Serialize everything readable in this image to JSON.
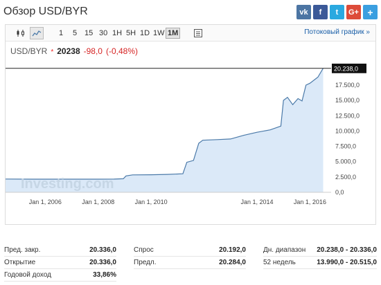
{
  "header": {
    "title": "Обзор USD/BYR",
    "share": [
      {
        "label": "vk",
        "icon": "vk-icon"
      },
      {
        "label": "f",
        "icon": "facebook-icon"
      },
      {
        "label": "t",
        "icon": "twitter-icon"
      },
      {
        "label": "G+",
        "icon": "google-plus-icon"
      },
      {
        "label": "+",
        "icon": "plus-icon"
      }
    ]
  },
  "toolbar": {
    "timeframes": [
      "1",
      "5",
      "15",
      "30",
      "1H",
      "5H",
      "1D",
      "1W",
      "1M"
    ],
    "active_timeframe": "1M",
    "stream_link": "Потоковый график »"
  },
  "quote": {
    "symbol": "USD/BYR",
    "star": "*",
    "last": "20238",
    "change": "-98,0",
    "change_pct": "(-0,48%)"
  },
  "chart_data": {
    "type": "area",
    "x_tick_labels": [
      "Jan 1, 2006",
      "Jan 1, 2008",
      "Jan 1, 2010",
      "Jan 1, 2014",
      "Jan 1, 2016"
    ],
    "x_ticks": [
      2006,
      2008,
      2010,
      2014,
      2016
    ],
    "y_tick_labels": [
      "20.000,0",
      "17.500,0",
      "15.000,0",
      "12.500,0",
      "10.000,0",
      "7.500,0",
      "5.000,0",
      "2.500,0",
      "0,0"
    ],
    "y_ticks": [
      20000,
      17500,
      15000,
      12500,
      10000,
      7500,
      5000,
      2500,
      0
    ],
    "ylim": [
      0,
      21000
    ],
    "xlim": [
      2004.5,
      2016.8
    ],
    "current_label": "20.238,0",
    "current_value": 20238,
    "watermark": "Investing.com",
    "points": [
      [
        2004.5,
        2170
      ],
      [
        2005.5,
        2150
      ],
      [
        2006.5,
        2140
      ],
      [
        2007.4,
        2150
      ],
      [
        2008.0,
        2140
      ],
      [
        2008.6,
        2160
      ],
      [
        2008.95,
        2210
      ],
      [
        2009.05,
        2680
      ],
      [
        2009.3,
        2850
      ],
      [
        2010.0,
        2870
      ],
      [
        2010.6,
        2920
      ],
      [
        2011.2,
        3030
      ],
      [
        2011.35,
        4900
      ],
      [
        2011.6,
        5200
      ],
      [
        2011.8,
        8000
      ],
      [
        2011.95,
        8500
      ],
      [
        2012.5,
        8600
      ],
      [
        2013.0,
        8700
      ],
      [
        2013.5,
        9300
      ],
      [
        2014.0,
        9800
      ],
      [
        2014.5,
        10200
      ],
      [
        2014.9,
        10800
      ],
      [
        2015.0,
        15000
      ],
      [
        2015.15,
        15500
      ],
      [
        2015.35,
        14300
      ],
      [
        2015.55,
        15300
      ],
      [
        2015.7,
        14900
      ],
      [
        2015.85,
        17500
      ],
      [
        2016.0,
        17800
      ],
      [
        2016.3,
        18800
      ],
      [
        2016.5,
        20238
      ]
    ]
  },
  "stats": {
    "prev_close_label": "Пред. закр.",
    "prev_close": "20.336,0",
    "open_label": "Открытие",
    "open": "20.336,0",
    "yearly_label": "Годовой доход",
    "yearly": "33,86%",
    "bid_label": "Спрос",
    "bid": "20.192,0",
    "prev_label": "Предл.",
    "prev": "20.284,0",
    "day_range_label": "Дн. диапазон",
    "day_range": "20.238,0 - 20.336,0",
    "week52_label": "52 недель",
    "week52": "13.990,0 - 20.515,0"
  },
  "colors": {
    "line": "#4a79a8",
    "fill": "#dbe9f8",
    "negative": "#d62525",
    "link": "#1a5fa8"
  }
}
